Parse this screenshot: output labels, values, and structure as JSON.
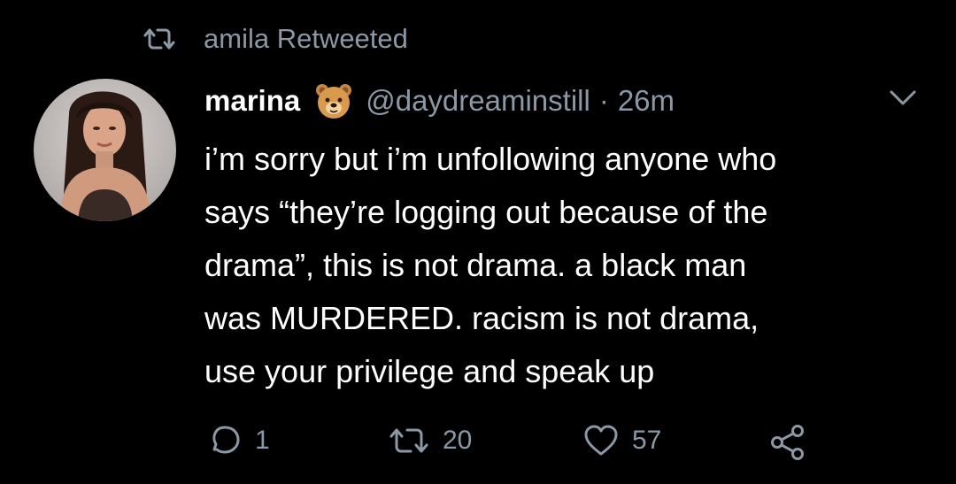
{
  "retweet_context": {
    "icon": "retweet-icon",
    "text": "amila Retweeted"
  },
  "tweet": {
    "author_name": "marina",
    "author_emoji": "bear-face-emoji",
    "handle": "@daydreaminstill",
    "separator": "·",
    "time": "26m",
    "text_lines": [
      "i’m sorry but i’m unfollowing anyone who",
      "says “they’re logging out because of the",
      "drama”, this is not drama. a black man",
      "was MURDERED. racism is not drama,",
      "use your privilege and speak up"
    ]
  },
  "actions": {
    "reply_count": "1",
    "retweet_count": "20",
    "like_count": "57"
  },
  "colors": {
    "background": "#000000",
    "text": "#ffffff",
    "secondary": "#8b98a5"
  }
}
